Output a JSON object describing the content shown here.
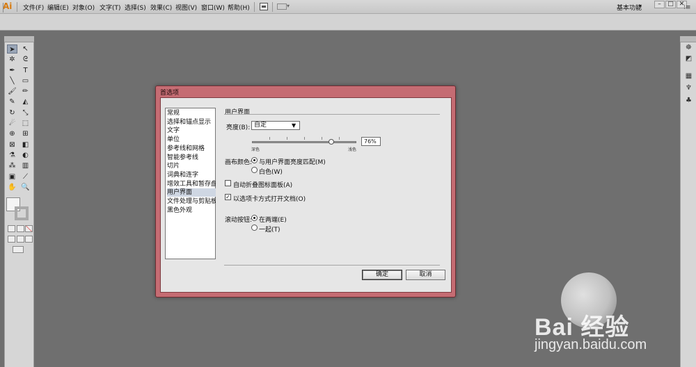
{
  "app": {
    "logo": "Ai"
  },
  "menubar": {
    "items": [
      "文件(F)",
      "编辑(E)",
      "对象(O)",
      "文字(T)",
      "选择(S)",
      "效果(C)",
      "视图(V)",
      "窗口(W)",
      "帮助(H)"
    ],
    "workspace": "基本功能",
    "window_buttons": [
      "–",
      "□",
      "✕"
    ]
  },
  "toolbox": {
    "tools": [
      {
        "name": "selection-tool",
        "glyph": "➤"
      },
      {
        "name": "direct-selection-tool",
        "glyph": "↖"
      },
      {
        "name": "magic-wand-tool",
        "glyph": "✲"
      },
      {
        "name": "lasso-tool",
        "glyph": "ᘓ"
      },
      {
        "name": "pen-tool",
        "glyph": "✒"
      },
      {
        "name": "type-tool",
        "glyph": "T"
      },
      {
        "name": "line-tool",
        "glyph": "╲"
      },
      {
        "name": "rectangle-tool",
        "glyph": "▭"
      },
      {
        "name": "paintbrush-tool",
        "glyph": "🖌"
      },
      {
        "name": "pencil-tool",
        "glyph": "✏"
      },
      {
        "name": "blob-brush-tool",
        "glyph": "✎"
      },
      {
        "name": "eraser-tool",
        "glyph": "◭"
      },
      {
        "name": "rotate-tool",
        "glyph": "↻"
      },
      {
        "name": "scale-tool",
        "glyph": "⤡"
      },
      {
        "name": "warp-tool",
        "glyph": "☄"
      },
      {
        "name": "free-transform-tool",
        "glyph": "⬚"
      },
      {
        "name": "shape-builder-tool",
        "glyph": "⊕"
      },
      {
        "name": "perspective-grid-tool",
        "glyph": "⊞"
      },
      {
        "name": "mesh-tool",
        "glyph": "⊠"
      },
      {
        "name": "gradient-tool",
        "glyph": "◧"
      },
      {
        "name": "eyedropper-tool",
        "glyph": "⚗"
      },
      {
        "name": "blend-tool",
        "glyph": "◐"
      },
      {
        "name": "symbol-sprayer-tool",
        "glyph": "⁂"
      },
      {
        "name": "column-graph-tool",
        "glyph": "▥"
      },
      {
        "name": "artboard-tool",
        "glyph": "▣"
      },
      {
        "name": "slice-tool",
        "glyph": "⟋"
      },
      {
        "name": "hand-tool",
        "glyph": "✋"
      },
      {
        "name": "zoom-tool",
        "glyph": "🔍"
      }
    ]
  },
  "rightpanel": {
    "icons": [
      {
        "name": "color-panel-icon",
        "glyph": "☸"
      },
      {
        "name": "color-guide-icon",
        "glyph": "◩"
      },
      {
        "name": "swatches-icon",
        "glyph": "▦"
      },
      {
        "name": "brushes-icon",
        "glyph": "♆"
      },
      {
        "name": "symbols-icon",
        "glyph": "♣"
      }
    ]
  },
  "dialog": {
    "title": "首选项",
    "categories": [
      "常规",
      "选择和锚点显示",
      "文字",
      "单位",
      "参考线和网格",
      "智能参考线",
      "切片",
      "词典和连字",
      "增效工具和暂存盘",
      "用户界面",
      "文件处理与剪贴板",
      "黑色外观"
    ],
    "selected_category": "用户界面",
    "section_title": "用户界面",
    "brightness": {
      "label": "亮度(B):",
      "value": "自定",
      "slider_value_text": "76%",
      "slider_fraction": 0.76,
      "min_label": "深色",
      "max_label": "浅色"
    },
    "canvas_color": {
      "label": "画布颜色:",
      "options": [
        "与用户界面亮度匹配(M)",
        "白色(W)"
      ],
      "selected_index": 0
    },
    "auto_collapse": {
      "label": "自动折叠图标面板(A)",
      "checked": false
    },
    "open_as_tabs": {
      "label": "以选项卡方式打开文档(O)",
      "checked": true
    },
    "scroll_buttons": {
      "label": "滚动按钮:",
      "options": [
        "在两端(E)",
        "一起(T)"
      ],
      "selected_index": 0
    },
    "ok_label": "确定",
    "cancel_label": "取消"
  },
  "watermark": {
    "logo": "Bai 经验",
    "url": "jingyan.baidu.com"
  }
}
